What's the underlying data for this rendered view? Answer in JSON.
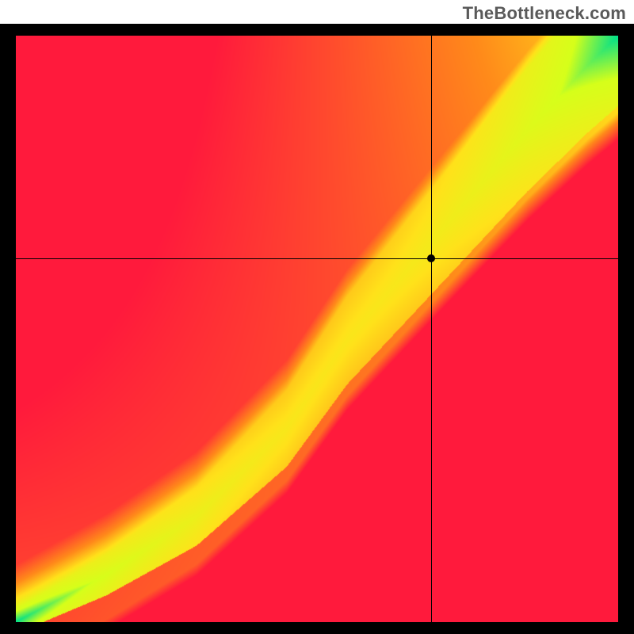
{
  "brand": "TheBottleneck.com",
  "chart_data": {
    "type": "heatmap",
    "title": "",
    "xlabel": "",
    "ylabel": "",
    "xlim": [
      0,
      100
    ],
    "ylim": [
      0,
      100
    ],
    "crosshair": {
      "x": 69,
      "y": 62
    },
    "marker": {
      "x": 69,
      "y": 62
    },
    "ridge": [
      {
        "x": 0,
        "y": 0
      },
      {
        "x": 15,
        "y": 8
      },
      {
        "x": 30,
        "y": 18
      },
      {
        "x": 45,
        "y": 33
      },
      {
        "x": 55,
        "y": 48
      },
      {
        "x": 65,
        "y": 60
      },
      {
        "x": 75,
        "y": 72
      },
      {
        "x": 85,
        "y": 84
      },
      {
        "x": 95,
        "y": 95
      },
      {
        "x": 100,
        "y": 100
      }
    ],
    "palette": {
      "low": "#ff1a3c",
      "mid_low": "#ff8a1a",
      "mid": "#ffe21a",
      "mid_high": "#d6ff1a",
      "high": "#00e08a"
    },
    "border": "#000000"
  }
}
